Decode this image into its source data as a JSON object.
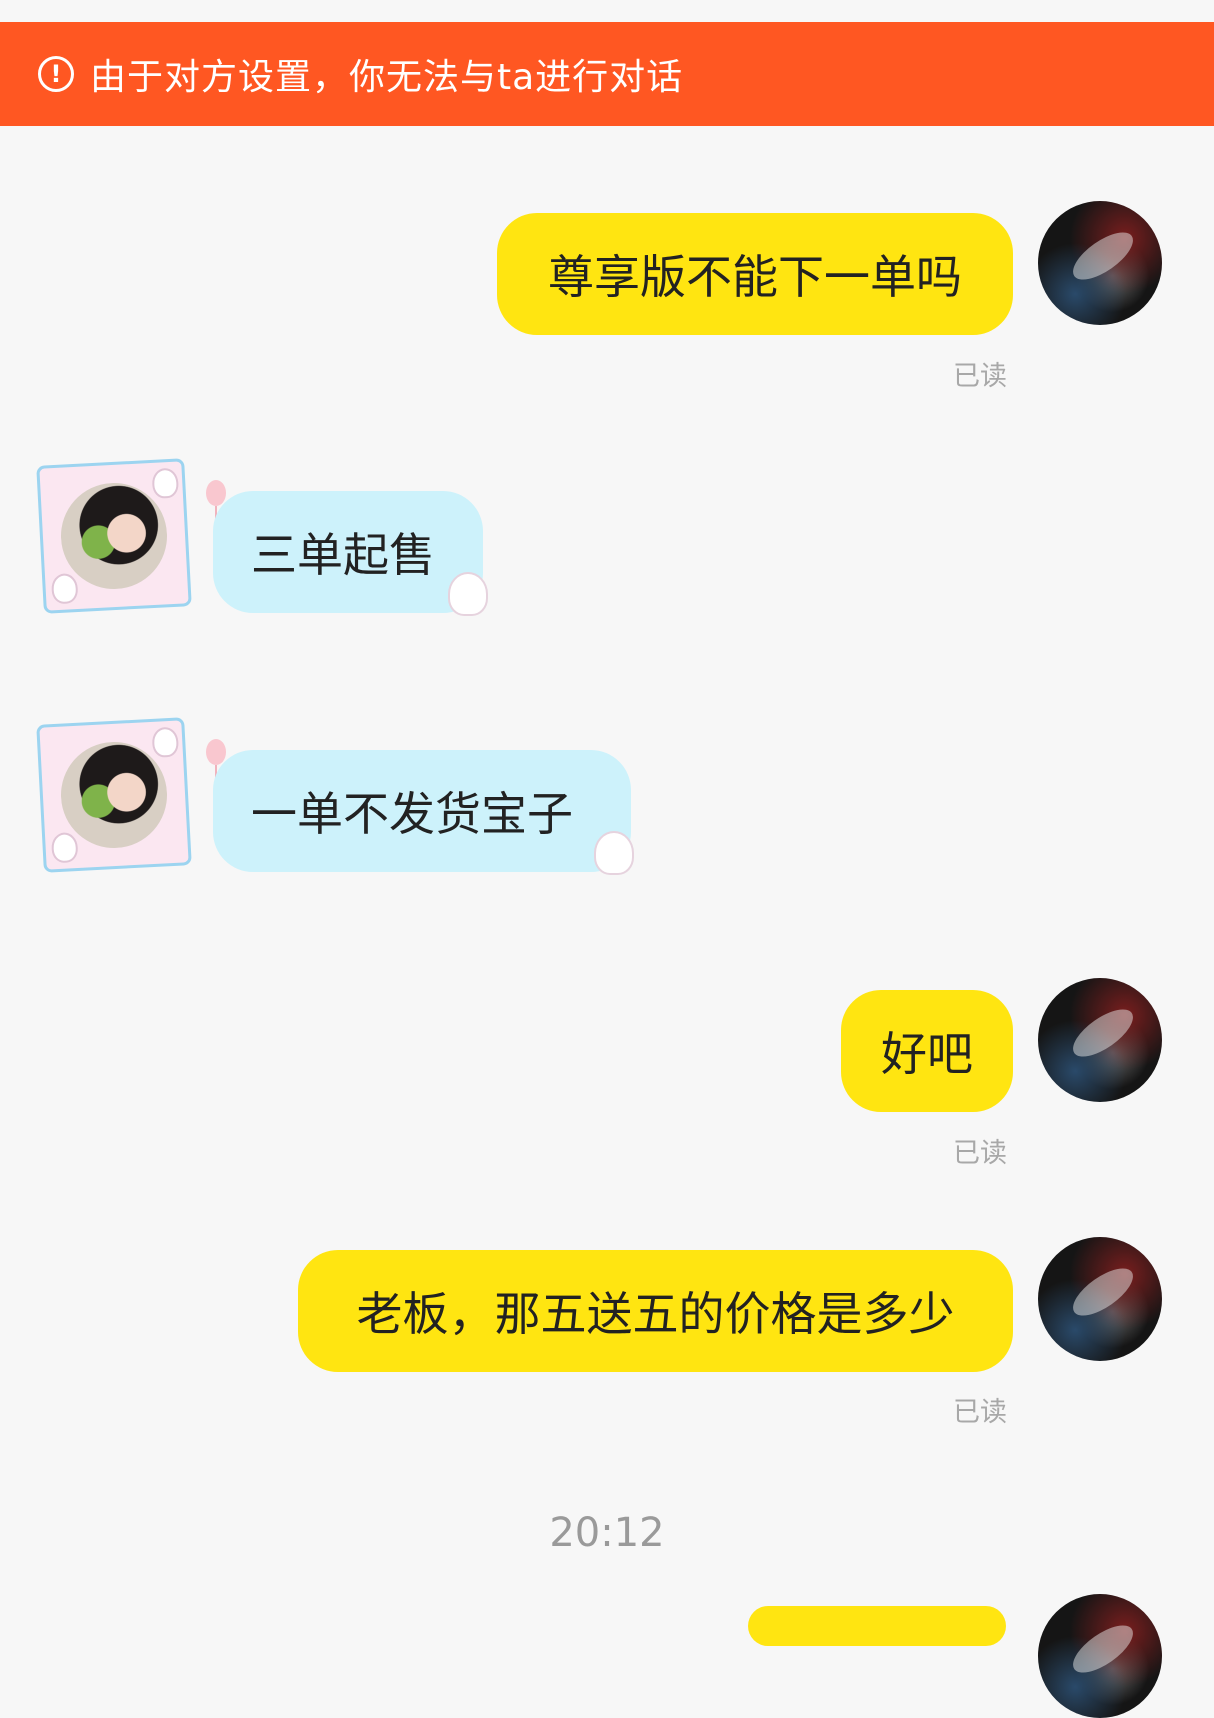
{
  "banner": {
    "icon": "alert-circle-icon",
    "text": "由于对方设置，你无法与ta进行对话",
    "color": "#ff5722"
  },
  "messages": [
    {
      "sender": "me",
      "text": "尊享版不能下一单吗",
      "status": "已读"
    },
    {
      "sender": "them",
      "text": "三单起售"
    },
    {
      "sender": "them",
      "text": "一单不发货宝子"
    },
    {
      "sender": "me",
      "text": "好吧",
      "status": "已读"
    },
    {
      "sender": "me",
      "text": "老板，那五送五的价格是多少",
      "status": "已读"
    }
  ],
  "timestamp": "20:12",
  "colors": {
    "outgoing_bubble": "#ffe511",
    "incoming_bubble": "#cdf2fb",
    "background": "#f7f7f7"
  }
}
